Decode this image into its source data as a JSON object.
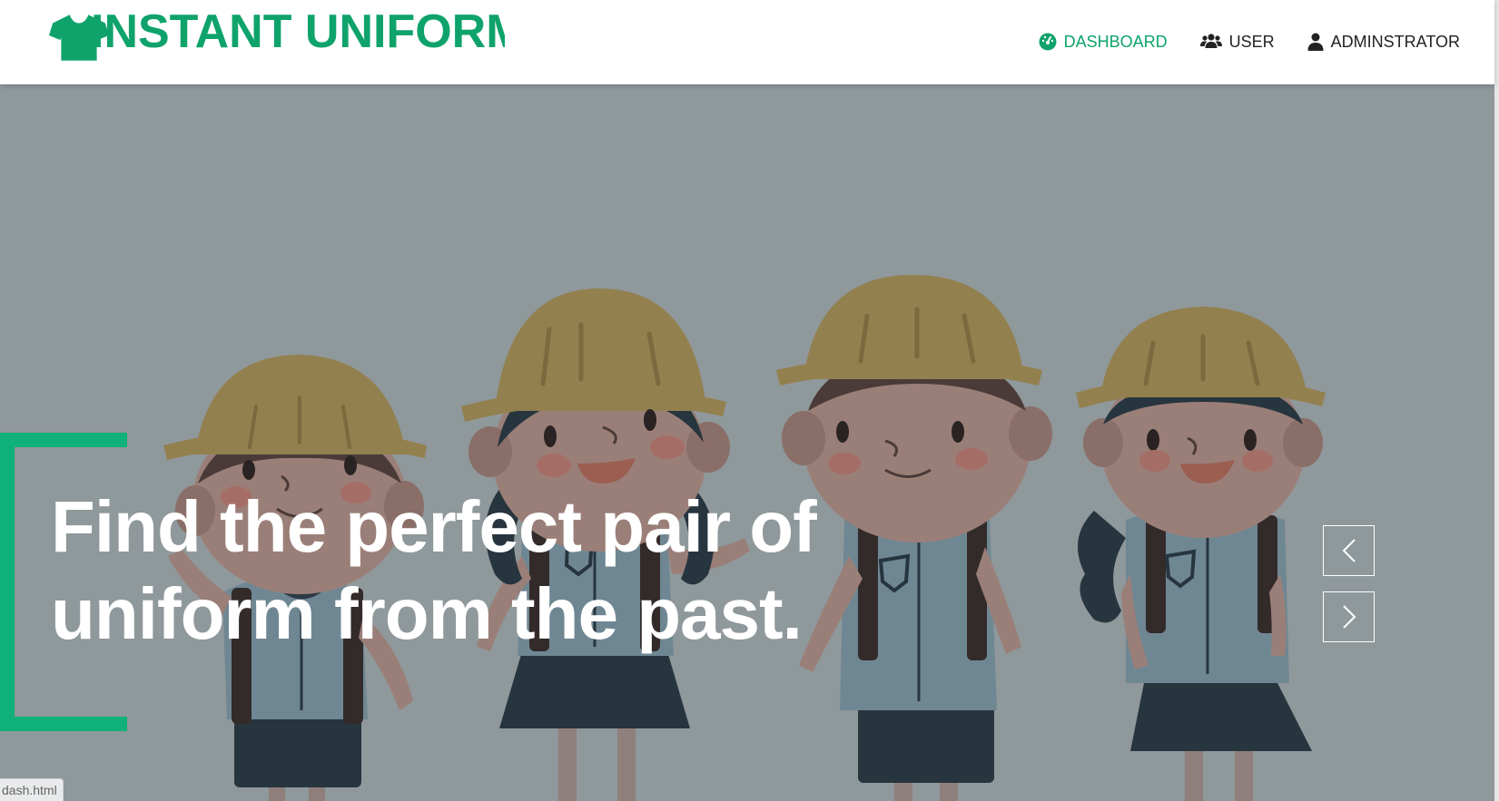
{
  "brand": {
    "name": "INSTANT UNIFORM",
    "icon": "tshirt-icon",
    "color": "#0fa36b"
  },
  "nav": {
    "items": [
      {
        "label": "DASHBOARD",
        "icon": "gauge-icon",
        "active": true
      },
      {
        "label": "USER",
        "icon": "users-icon",
        "active": false
      },
      {
        "label": "ADMINSTRATOR",
        "icon": "user-icon",
        "active": false
      }
    ]
  },
  "hero": {
    "headline_line1": "Find the perfect pair of",
    "headline_line2": "uniform from the past.",
    "accent_color": "#0fb07a",
    "prev_icon": "chevron-left-icon",
    "next_icon": "chevron-right-icon"
  },
  "status": {
    "url_text": "dash.html"
  }
}
